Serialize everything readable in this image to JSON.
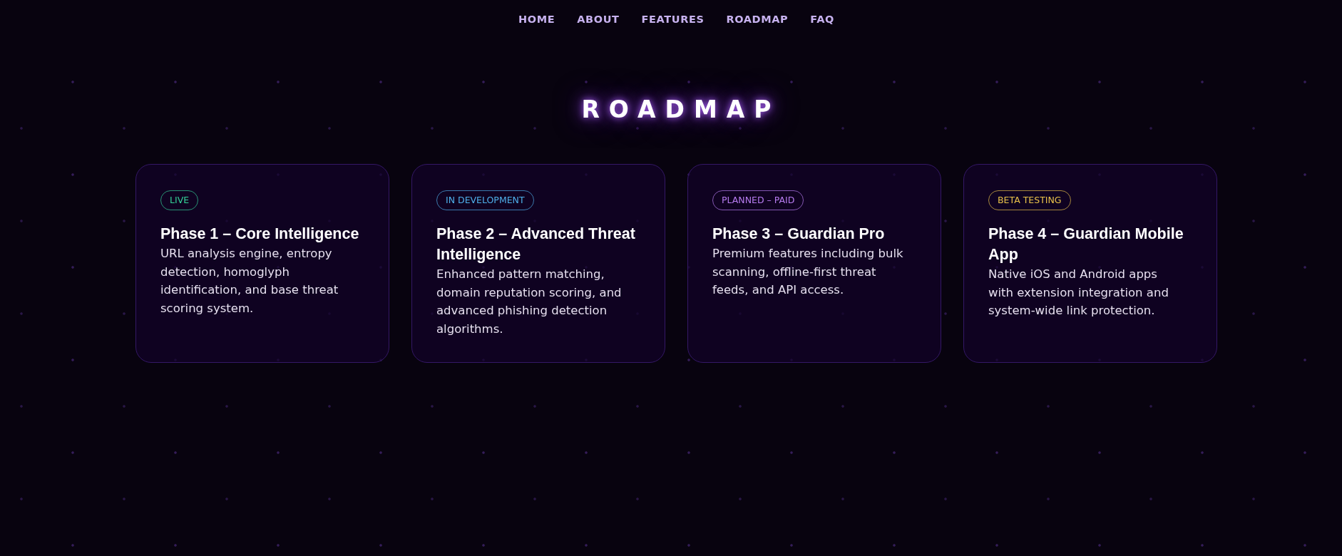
{
  "nav": [
    "HOME",
    "ABOUT",
    "FEATURES",
    "ROADMAP",
    "FAQ"
  ],
  "section": {
    "title": "ROADMAP"
  },
  "phases": [
    {
      "status": {
        "label": "LIVE",
        "color": "#34d399"
      },
      "title": "Phase 1 – Core Intelligence",
      "description": "URL analysis engine, entropy detection, homoglyph identification, and base threat scoring system."
    },
    {
      "status": {
        "label": "IN DEVELOPMENT",
        "color": "#4fb0ea"
      },
      "title": "Phase 2 – Advanced Threat Intelligence",
      "description": "Enhanced pattern matching, domain reputation scoring, and advanced phishing detection algorithms."
    },
    {
      "status": {
        "label": "PLANNED – PAID",
        "color": "#b77cf0"
      },
      "title": "Phase 3 – Guardian Pro",
      "description": "Premium features including bulk scanning, offline-first threat feeds, and API access."
    },
    {
      "status": {
        "label": "BETA TESTING",
        "color": "#e9c24a"
      },
      "title": "Phase 4 – Guardian Mobile App",
      "description": "Native iOS and Android apps with extension integration and system-wide link protection."
    }
  ]
}
